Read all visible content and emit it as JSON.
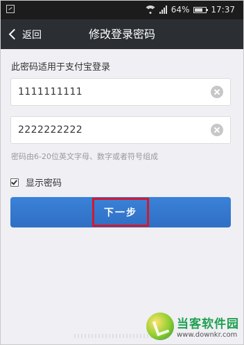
{
  "status_bar": {
    "battery_percent": "64%",
    "time": "17:37",
    "icons": [
      "image-icon",
      "wifi-icon",
      "signal-icon",
      "battery-icon"
    ]
  },
  "nav": {
    "back_label": "返回",
    "title": "修改登录密码"
  },
  "form": {
    "section_title": "此密码适用于支付宝登录",
    "password_value": "1111111111",
    "confirm_value": "2222222222",
    "hint": "密码由6-20位英文字母、数字或者符号组成",
    "show_password_label": "显示密码",
    "show_password_checked": true,
    "next_button_label": "下一步"
  },
  "watermark": {
    "name": "当客软件园",
    "url": "www.downkr.com"
  },
  "colors": {
    "nav_bg": "#2b2e33",
    "status_bg": "#1c1c1c",
    "page_bg": "#efeff4",
    "primary_button": "#3478d0",
    "highlight_border": "#d4192b"
  }
}
